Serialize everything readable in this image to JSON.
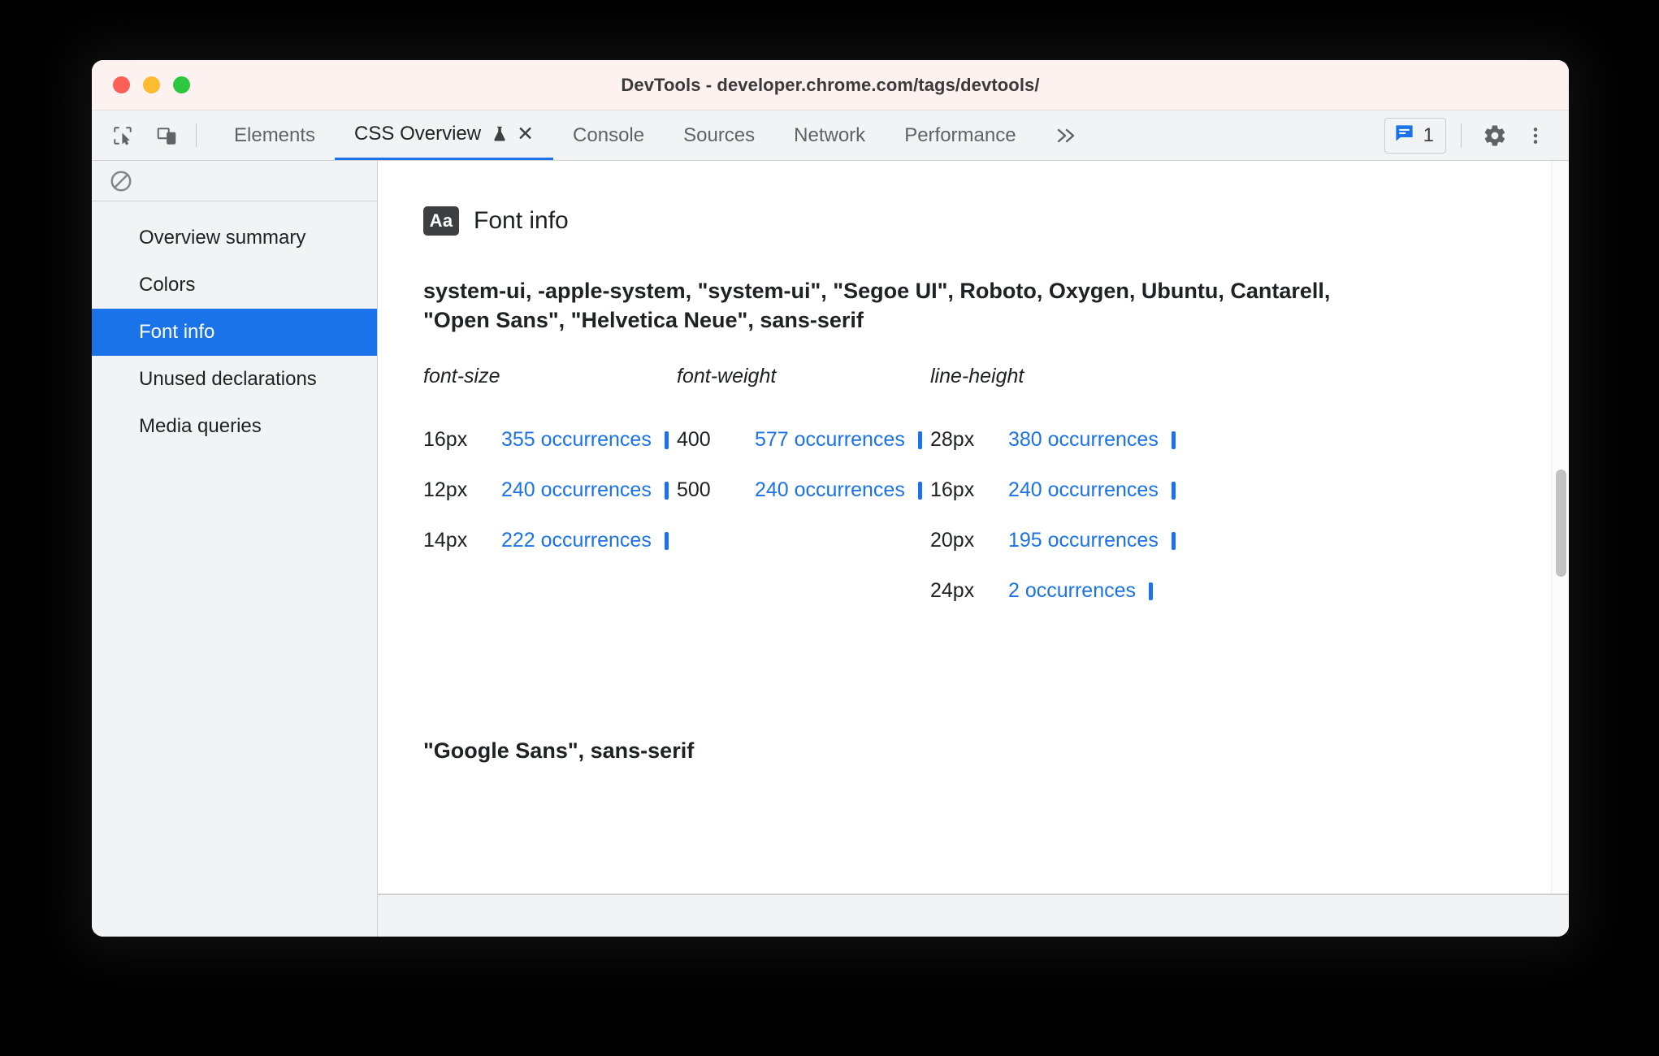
{
  "window": {
    "title": "DevTools - developer.chrome.com/tags/devtools/",
    "traffic_lights": [
      "close",
      "minimize",
      "zoom"
    ]
  },
  "toolbar": {
    "inspect_icon": "inspect-element-icon",
    "device_icon": "device-toolbar-icon",
    "more_tabs_label": "»",
    "issues_count": "1",
    "issues_icon": "issues-message-icon",
    "settings_icon": "gear-icon",
    "more_options_icon": "more-vertical-icon",
    "tabs": [
      {
        "label": "Elements",
        "active": false,
        "closable": false
      },
      {
        "label": "CSS Overview",
        "active": true,
        "closable": true,
        "experimental": true
      },
      {
        "label": "Console",
        "active": false,
        "closable": false
      },
      {
        "label": "Sources",
        "active": false,
        "closable": false
      },
      {
        "label": "Network",
        "active": false,
        "closable": false
      },
      {
        "label": "Performance",
        "active": false,
        "closable": false
      }
    ]
  },
  "sidebar": {
    "clear_icon": "clear-overview-icon",
    "items": [
      {
        "label": "Overview summary",
        "selected": false
      },
      {
        "label": "Colors",
        "selected": false
      },
      {
        "label": "Font info",
        "selected": true
      },
      {
        "label": "Unused declarations",
        "selected": false
      },
      {
        "label": "Media queries",
        "selected": false
      }
    ]
  },
  "main": {
    "section_badge": "Aa",
    "section_title": "Font info",
    "font_families": [
      {
        "name": "system-ui, -apple-system, \"system-ui\", \"Segoe UI\", Roboto, Oxygen, Ubuntu, Cantarell, \"Open Sans\", \"Helvetica Neue\", sans-serif",
        "columns": [
          {
            "header": "font-size",
            "rows": [
              {
                "value": "16px",
                "occurrences": "355 occurrences",
                "count": 355
              },
              {
                "value": "12px",
                "occurrences": "240 occurrences",
                "count": 240
              },
              {
                "value": "14px",
                "occurrences": "222 occurrences",
                "count": 222
              }
            ]
          },
          {
            "header": "font-weight",
            "rows": [
              {
                "value": "400",
                "occurrences": "577 occurrences",
                "count": 577
              },
              {
                "value": "500",
                "occurrences": "240 occurrences",
                "count": 240
              }
            ]
          },
          {
            "header": "line-height",
            "rows": [
              {
                "value": "28px",
                "occurrences": "380 occurrences",
                "count": 380
              },
              {
                "value": "16px",
                "occurrences": "240 occurrences",
                "count": 240
              },
              {
                "value": "20px",
                "occurrences": "195 occurrences",
                "count": 195
              },
              {
                "value": "24px",
                "occurrences": "2 occurrences",
                "count": 2
              }
            ]
          }
        ]
      },
      {
        "name": "\"Google Sans\", sans-serif",
        "columns": []
      }
    ]
  },
  "colors": {
    "accent_blue": "#1a73e8",
    "selected_row": "#1a73e8",
    "link": "#1a73e8",
    "titlebar_bg": "#fdf2f0",
    "toolbar_bg": "#f1f3f4",
    "text_primary": "#202124",
    "text_secondary": "#5f6368"
  }
}
